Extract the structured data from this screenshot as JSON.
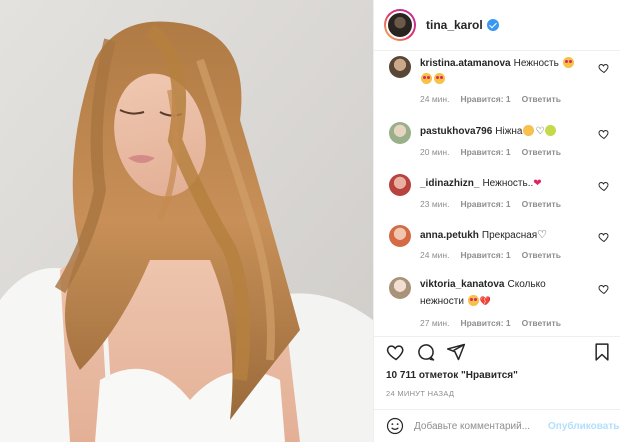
{
  "header": {
    "username": "tina_karol",
    "verified": true
  },
  "comments": [
    {
      "user": "kristina.atamanova",
      "text": "Нежность",
      "emoji": [
        "love-eyes",
        "love-eyes",
        "love-eyes"
      ],
      "time": "24 мин.",
      "likes": "Нравится: 1",
      "reply": "Ответить",
      "avatar_color": "#8a6d55"
    },
    {
      "user": "pastukhova796",
      "text": "Ніжна",
      "emoji": [
        "blush",
        "white-heart",
        "smile"
      ],
      "time": "20 мин.",
      "likes": "Нравится: 1",
      "reply": "Ответить",
      "avatar_color": "#a8b59a"
    },
    {
      "user": "_idinazhizn_",
      "text": "Нежность..",
      "emoji": [
        "red-heart"
      ],
      "time": "23 мин.",
      "likes": "Нравится: 1",
      "reply": "Ответить",
      "avatar_color": "#c0504d"
    },
    {
      "user": "anna.petukh",
      "text": "Прекрасная",
      "emoji": [
        "white-heart"
      ],
      "time": "24 мин.",
      "likes": "Нравится: 1",
      "reply": "Ответить",
      "avatar_color": "#d9684a"
    },
    {
      "user": "viktoria_kanatova",
      "text": "Сколько нежности",
      "emoji": [
        "love-eyes",
        "broken-heart"
      ],
      "time": "27 мин.",
      "likes": "Нравится: 1",
      "reply": "Ответить",
      "avatar_color": "#b8a38a"
    }
  ],
  "likes_line": "10 711 отметок \"Нравится\"",
  "time_ago": "24 МИНУТ НАЗАД",
  "add_comment": {
    "placeholder": "Добавьте комментарий...",
    "post_label": "Опубликовать"
  },
  "colors": {
    "accent": "#3897f0",
    "post_disabled": "#b2dffc",
    "muted": "#8e8e8e",
    "border": "#efefef"
  },
  "icons": [
    "heart-icon",
    "comment-icon",
    "share-icon",
    "bookmark-icon",
    "smiley-icon",
    "verified-icon"
  ]
}
